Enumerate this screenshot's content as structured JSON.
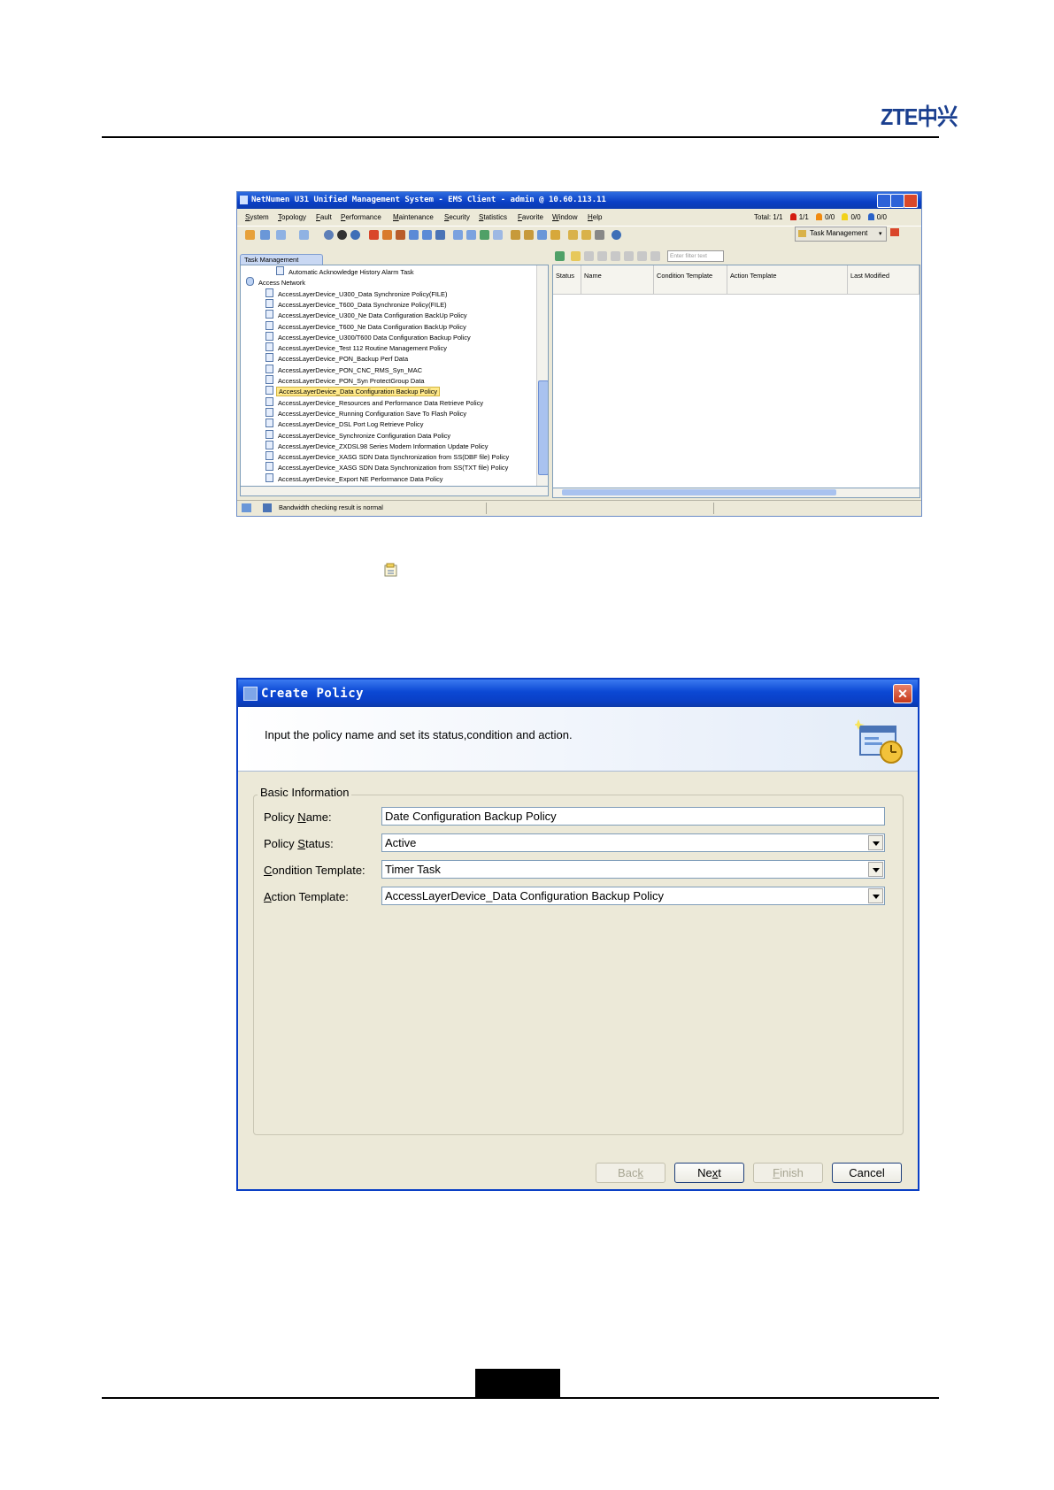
{
  "header": {
    "logo": "ZTE中兴"
  },
  "ems": {
    "title": "NetNumen U31 Unified Management System - EMS Client - admin @ 10.60.113.11",
    "menu": [
      "System",
      "Topology",
      "Fault",
      "Performance",
      "Maintenance",
      "Security",
      "Statistics",
      "Favorite",
      "Window",
      "Help"
    ],
    "alarms": {
      "total_label": "Total:",
      "total": "1/1",
      "red": "1/1",
      "orange": "0/0",
      "yellow": "0/0",
      "blue": "0/0"
    },
    "alarm_colors": {
      "red": "#d41c10",
      "orange": "#f08a10",
      "yellow": "#f2d21a",
      "blue": "#2a62c8"
    },
    "task_combo": "Task Management",
    "left_tab": "Task Management",
    "tree": [
      {
        "label": "Automatic Acknowledge History Alarm Task",
        "indent": 3,
        "type": "leaf"
      },
      {
        "label": "Access Network",
        "indent": 1,
        "type": "folder"
      },
      {
        "label": "AccessLayerDevice_U300_Data Synchronize Policy(FILE)",
        "indent": 2,
        "type": "leaf"
      },
      {
        "label": "AccessLayerDevice_T600_Data Synchronize Policy(FILE)",
        "indent": 2,
        "type": "leaf"
      },
      {
        "label": "AccessLayerDevice_U300_Ne Data Configuration BackUp Policy",
        "indent": 2,
        "type": "leaf"
      },
      {
        "label": "AccessLayerDevice_T600_Ne Data Configuration BackUp Policy",
        "indent": 2,
        "type": "leaf"
      },
      {
        "label": "AccessLayerDevice_U300/T600 Data Configuration Backup Policy",
        "indent": 2,
        "type": "leaf"
      },
      {
        "label": "AccessLayerDevice_Test 112 Routine Management Policy",
        "indent": 2,
        "type": "leaf"
      },
      {
        "label": "AccessLayerDevice_PON_Backup Perf Data",
        "indent": 2,
        "type": "leaf"
      },
      {
        "label": "AccessLayerDevice_PON_CNC_RMS_Syn_MAC",
        "indent": 2,
        "type": "leaf"
      },
      {
        "label": "AccessLayerDevice_PON_Syn ProtectGroup Data",
        "indent": 2,
        "type": "leaf"
      },
      {
        "label": "AccessLayerDevice_Data Configuration Backup Policy",
        "indent": 2,
        "type": "leaf",
        "selected": true
      },
      {
        "label": "AccessLayerDevice_Resources and Performance Data Retrieve Policy",
        "indent": 2,
        "type": "leaf"
      },
      {
        "label": "AccessLayerDevice_Running Configuration Save To Flash Policy",
        "indent": 2,
        "type": "leaf"
      },
      {
        "label": "AccessLayerDevice_DSL Port Log Retrieve Policy",
        "indent": 2,
        "type": "leaf"
      },
      {
        "label": "AccessLayerDevice_Synchronize Configuration Data Policy",
        "indent": 2,
        "type": "leaf"
      },
      {
        "label": "AccessLayerDevice_ZXDSL98 Series Modem Information Update Policy",
        "indent": 2,
        "type": "leaf"
      },
      {
        "label": "AccessLayerDevice_XASG SDN Data Synchronization from SS(DBF file) Policy",
        "indent": 2,
        "type": "leaf"
      },
      {
        "label": "AccessLayerDevice_XASG SDN Data Synchronization from SS(TXT file) Policy",
        "indent": 2,
        "type": "leaf"
      },
      {
        "label": "AccessLayerDevice_Export NE Performance Data Policy",
        "indent": 2,
        "type": "leaf"
      }
    ],
    "filter_placeholder": "Enter filter text",
    "columns": [
      "Status",
      "Name",
      "Condition Template",
      "Action Template",
      "Last Modified"
    ],
    "status_text": "Bandwidth checking result is normal"
  },
  "dialog": {
    "title": "Create Policy",
    "description": "Input the policy name and set its status,condition and action.",
    "group": "Basic Information",
    "fields": {
      "policy_name": {
        "label_pre": "Policy ",
        "label_mn": "N",
        "label_post": "ame:",
        "value": "Date Configuration Backup Policy"
      },
      "policy_status": {
        "label_pre": "Policy ",
        "label_mn": "S",
        "label_post": "tatus:",
        "value": "Active"
      },
      "condition_template": {
        "label_pre": "",
        "label_mn": "C",
        "label_post": "ondition Template:",
        "value": "Timer Task"
      },
      "action_template": {
        "label_pre": "",
        "label_mn": "A",
        "label_post": "ction Template:",
        "value": "AccessLayerDevice_Data Configuration Backup Policy"
      }
    },
    "buttons": {
      "back": {
        "pre": "Bac",
        "mn": "k",
        "post": ""
      },
      "next": {
        "pre": "Ne",
        "mn": "x",
        "post": "t"
      },
      "finish": {
        "pre": "",
        "mn": "F",
        "post": "inish"
      },
      "cancel": "Cancel"
    }
  }
}
